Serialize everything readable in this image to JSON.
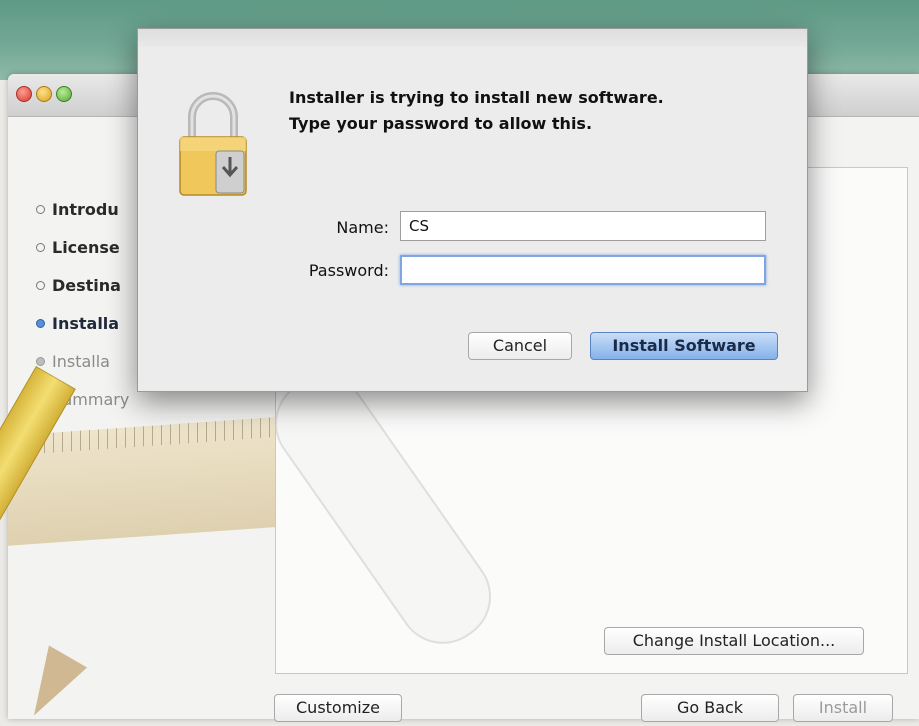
{
  "window": {
    "steps": [
      {
        "label": "Introdu",
        "state": "done"
      },
      {
        "label": "License",
        "state": "done"
      },
      {
        "label": "Destina",
        "state": "done"
      },
      {
        "label": "Installa",
        "state": "active"
      },
      {
        "label": "Installa",
        "state": "pending"
      },
      {
        "label": "Summary",
        "state": "pending"
      }
    ],
    "change_location_label": "Change Install Location...",
    "customize_label": "Customize",
    "go_back_label": "Go Back",
    "install_label": "Install"
  },
  "dialog": {
    "message_line1": "Installer is trying to install new software.",
    "message_line2": "Type your password to allow this.",
    "name_label": "Name:",
    "name_value": "CS",
    "password_label": "Password:",
    "password_value": "",
    "cancel_label": "Cancel",
    "confirm_label": "Install Software"
  },
  "icons": {
    "lock": "lock-icon",
    "traffic_lights": [
      "close",
      "minimize",
      "zoom"
    ]
  },
  "colors": {
    "accent": "#86b1ea",
    "focus_ring": "#7fa6e0",
    "active_bullet": "#5a8fd8"
  }
}
